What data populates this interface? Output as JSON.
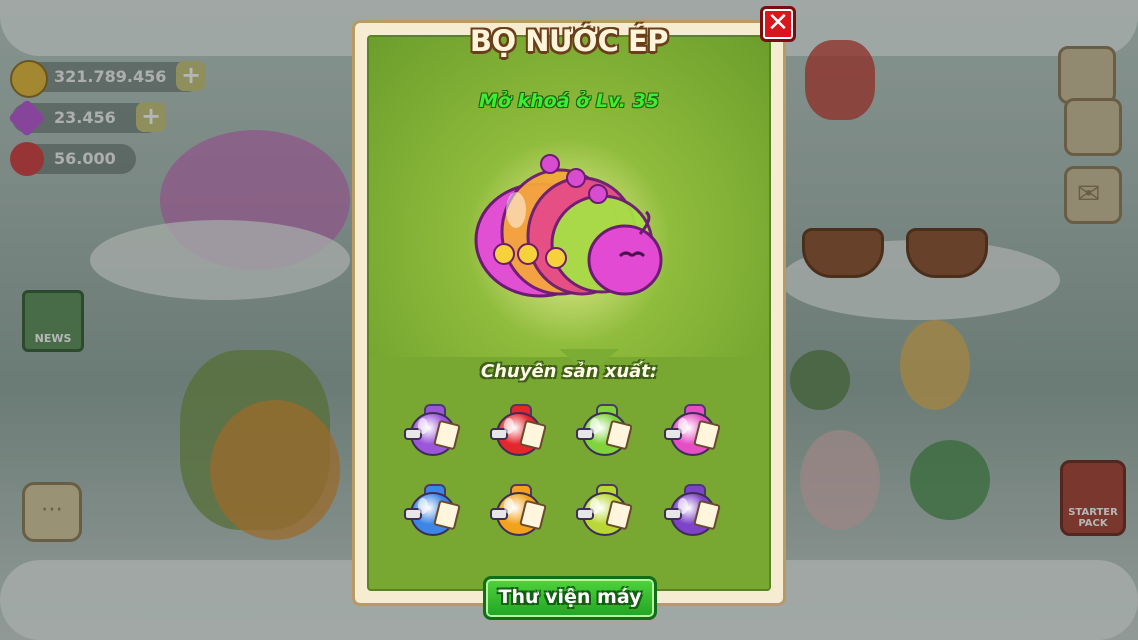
{
  "currency": {
    "coins": "321.789.456",
    "gems": "23.456",
    "hearts": "56.000"
  },
  "hud": {
    "news_label": "NEWS",
    "starter_pack_label": "STARTER PACK"
  },
  "popup": {
    "title": "BỌ NƯỚC ÉP",
    "unlock_text": "Mở khoá ở Lv. 35",
    "products_label": "Chuyên sản xuất:",
    "library_button": "Thư viện máy",
    "close_icon": "close-icon"
  },
  "products": [
    {
      "name": "purple-juice-jar-icon",
      "color": "#9b57d9"
    },
    {
      "name": "red-juice-jar-icon",
      "color": "#e4272c"
    },
    {
      "name": "green-juice-jar-icon",
      "color": "#7fd43d"
    },
    {
      "name": "pink-juice-jar-icon",
      "color": "#e64fc4"
    },
    {
      "name": "blue-juice-jar-icon",
      "color": "#3d86e6"
    },
    {
      "name": "orange-juice-jar-icon",
      "color": "#f2a21c"
    },
    {
      "name": "lime-juice-jar-icon",
      "color": "#b9d835"
    },
    {
      "name": "grape-juice-jar-icon",
      "color": "#7d43c9"
    }
  ]
}
